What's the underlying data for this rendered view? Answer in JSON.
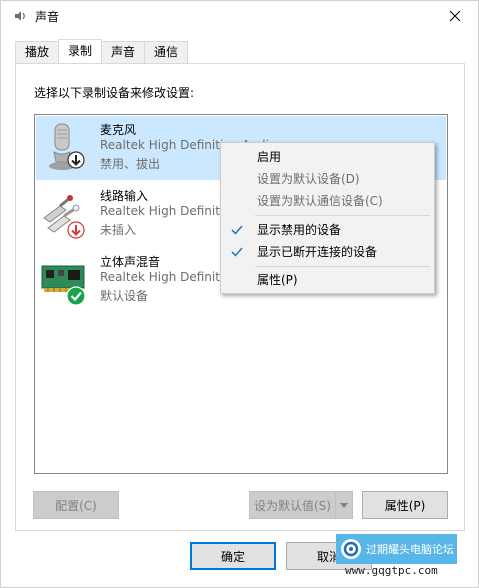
{
  "window": {
    "title": "声音"
  },
  "tabs": [
    {
      "label": "播放"
    },
    {
      "label": "录制"
    },
    {
      "label": "声音"
    },
    {
      "label": "通信"
    }
  ],
  "instruction": "选择以下录制设备来修改设置:",
  "devices": [
    {
      "name": "麦克风",
      "driver": "Realtek High Definition Audio",
      "status": "禁用、拔出",
      "icon": "microphone-icon",
      "badge": "down-arrow-badge",
      "selected": true
    },
    {
      "name": "线路输入",
      "driver": "Realtek High Definition Audio",
      "status": "未插入",
      "icon": "line-in-cable-icon",
      "badge": "red-down-arrow-badge",
      "selected": false
    },
    {
      "name": "立体声混音",
      "driver": "Realtek High Definition Audio",
      "status": "默认设备",
      "icon": "sound-card-icon",
      "badge": "green-check-badge",
      "selected": false
    }
  ],
  "context_menu": {
    "items": [
      {
        "label": "启用",
        "disabled": false,
        "checked": false
      },
      {
        "label": "设置为默认设备(D)",
        "disabled": true,
        "checked": false
      },
      {
        "label": "设置为默认通信设备(C)",
        "disabled": true,
        "checked": false
      },
      {
        "label": "显示禁用的设备",
        "disabled": false,
        "checked": true
      },
      {
        "label": "显示已断开连接的设备",
        "disabled": false,
        "checked": true
      },
      {
        "label": "属性(P)",
        "disabled": false,
        "checked": false
      }
    ]
  },
  "buttons": {
    "configure": "配置(C)",
    "set_default": "设为默认值(S)",
    "properties": "属性(P)",
    "ok": "确定",
    "cancel": "取消"
  },
  "watermark": {
    "text": "过期耀头电脑论坛",
    "url": "www.gqgtpc.com"
  },
  "colors": {
    "selection": "#cce8ff",
    "accent": "#0078d7",
    "check": "#2a7cc9",
    "watermark_bg": "#58b6e8"
  }
}
